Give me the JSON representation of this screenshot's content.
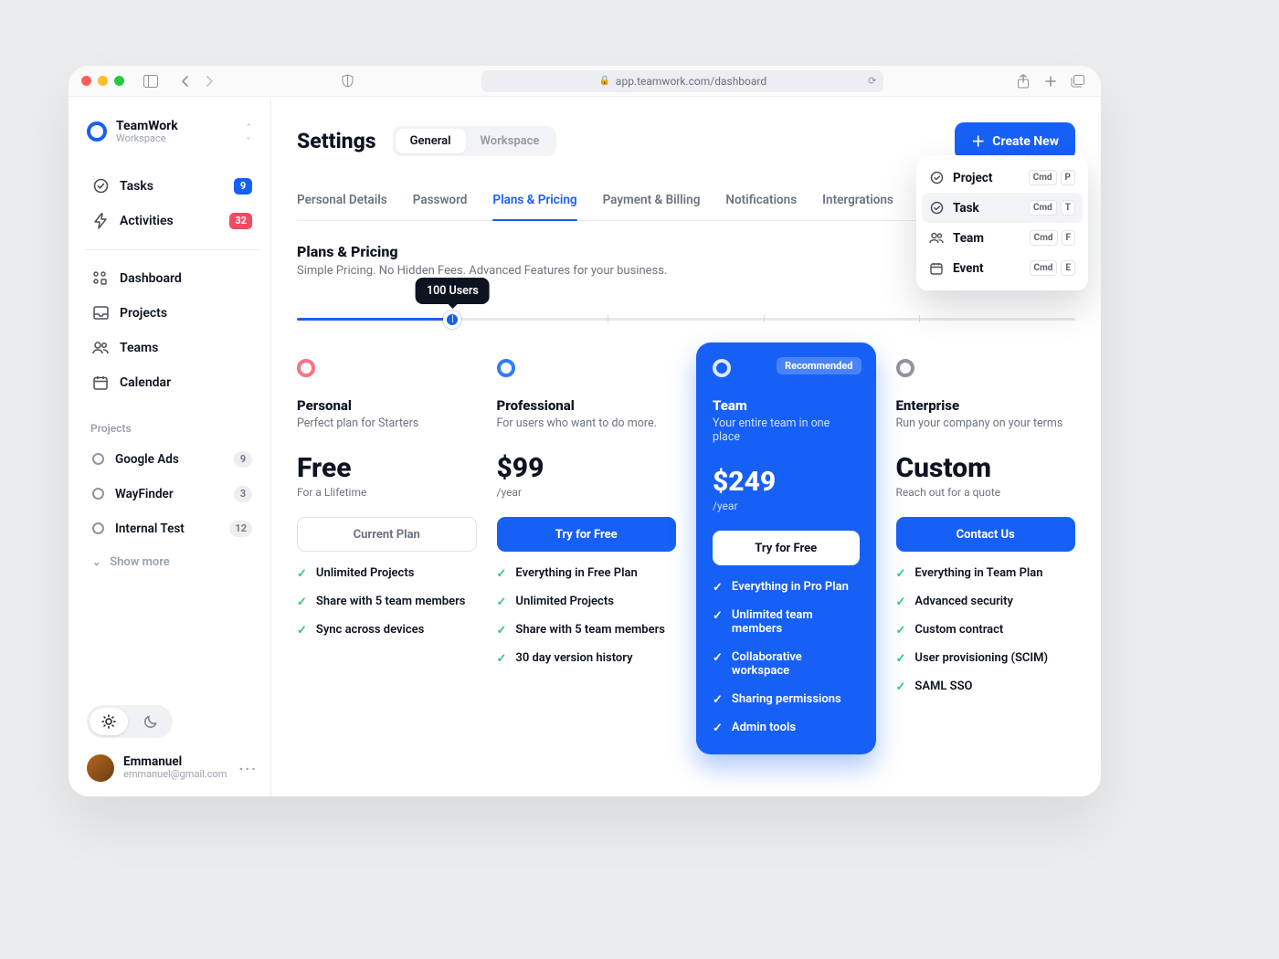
{
  "browser": {
    "url": "app.teamwork.com/dashboard"
  },
  "sidebar": {
    "brand_name": "TeamWork",
    "brand_sub": "Workspace",
    "items": [
      {
        "icon": "check-circle-icon",
        "label": "Tasks",
        "badge": "9",
        "badge_style": "blue"
      },
      {
        "icon": "bolt-icon",
        "label": "Activities",
        "badge": "32",
        "badge_style": "red"
      }
    ],
    "nav": [
      {
        "icon": "grid-icon",
        "label": "Dashboard"
      },
      {
        "icon": "inbox-icon",
        "label": "Projects"
      },
      {
        "icon": "users-icon",
        "label": "Teams"
      },
      {
        "icon": "calendar-icon",
        "label": "Calendar"
      }
    ],
    "projects_header": "Projects",
    "projects": [
      {
        "label": "Google Ads",
        "badge": "9"
      },
      {
        "label": "WayFinder",
        "badge": "3"
      },
      {
        "label": "Internal Test",
        "badge": "12"
      }
    ],
    "show_more": "Show more",
    "user": {
      "name": "Emmanuel",
      "email": "emmanuel@gmail.com"
    }
  },
  "header": {
    "title": "Settings",
    "segments": [
      {
        "label": "General",
        "active": true
      },
      {
        "label": "Workspace",
        "active": false
      }
    ],
    "create_button": "Create New",
    "dropdown": [
      {
        "icon": "check-circle-icon",
        "label": "Project",
        "cmd": "Cmd",
        "key": "P",
        "selected": false
      },
      {
        "icon": "check-circle-icon",
        "label": "Task",
        "cmd": "Cmd",
        "key": "T",
        "selected": true
      },
      {
        "icon": "users-icon",
        "label": "Team",
        "cmd": "Cmd",
        "key": "F",
        "selected": false
      },
      {
        "icon": "calendar-icon",
        "label": "Event",
        "cmd": "Cmd",
        "key": "E",
        "selected": false
      }
    ]
  },
  "tabs": [
    {
      "label": "Personal Details"
    },
    {
      "label": "Password"
    },
    {
      "label": "Plans & Pricing",
      "active": true
    },
    {
      "label": "Payment & Billing"
    },
    {
      "label": "Notifications"
    },
    {
      "label": "Intergrations"
    }
  ],
  "section": {
    "title": "Plans & Pricing",
    "sub": "Simple Pricing. No Hidden Fees. Advanced Features for your business."
  },
  "slider": {
    "tooltip": "100 Users",
    "percent": 20
  },
  "plans": [
    {
      "ring": "pink",
      "name": "Personal",
      "desc": "Perfect plan for Starters",
      "price": "Free",
      "period": "For a Llifetime",
      "cta": "Current Plan",
      "cta_style": "outline",
      "features": [
        "Unlimited Projects",
        "Share with 5 team members",
        "Sync across devices"
      ]
    },
    {
      "ring": "blue",
      "name": "Professional",
      "desc": "For users who want to do more.",
      "price": "$99",
      "period": "/year",
      "cta": "Try for Free",
      "cta_style": "solid",
      "features": [
        "Everything in Free Plan",
        "Unlimited Projects",
        "Share with 5 team members",
        "30 day version history"
      ]
    },
    {
      "ring": "white",
      "highlight": true,
      "recommended": "Recommended",
      "name": "Team",
      "desc": "Your entire team in one place",
      "price": "$249",
      "period": "/year",
      "cta": "Try for Free",
      "cta_style": "white",
      "features": [
        "Everything in Pro Plan",
        "Unlimited team members",
        "Collaborative workspace",
        "Sharing permissions",
        "Admin tools"
      ]
    },
    {
      "ring": "grey",
      "name": "Enterprise",
      "desc": "Run your company on your terms",
      "price": "Custom",
      "period": "Reach out for a quote",
      "cta": "Contact Us",
      "cta_style": "solid",
      "features": [
        "Everything in Team Plan",
        "Advanced security",
        "Custom contract",
        "User provisioning (SCIM)",
        "SAML SSO"
      ]
    }
  ]
}
